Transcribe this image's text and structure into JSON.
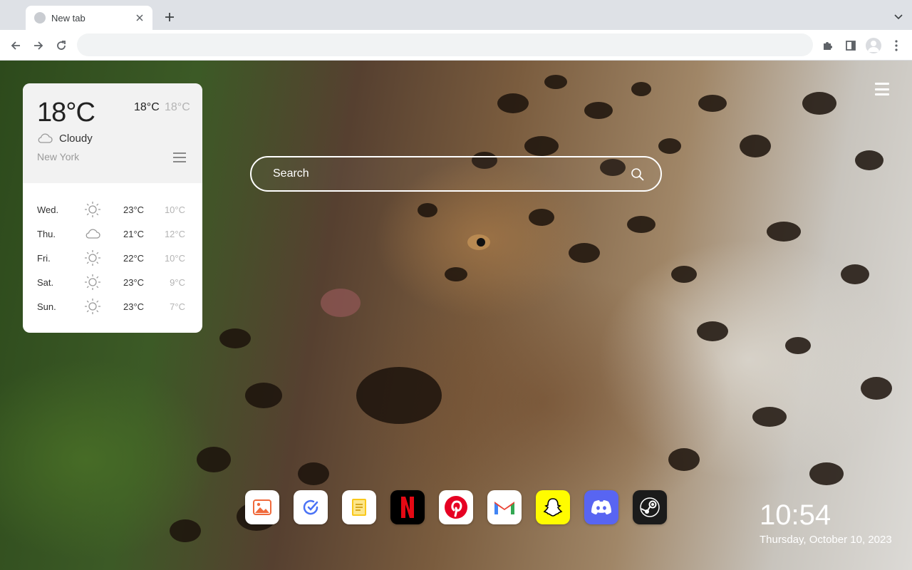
{
  "browser": {
    "tab_title": "New tab",
    "address_value": "",
    "icons": {
      "tab_close": "close-icon",
      "new_tab": "plus-icon",
      "tab_search": "chevron-down-icon",
      "back": "arrow-left-icon",
      "forward": "arrow-right-icon",
      "reload": "reload-icon",
      "extensions": "puzzle-icon",
      "side_panel": "side-panel-icon",
      "profile": "avatar-icon",
      "menu": "kebab-menu-icon"
    }
  },
  "weather": {
    "current_temp": "18°C",
    "high": "18°C",
    "low": "18°C",
    "condition": "Cloudy",
    "condition_icon": "cloud-icon",
    "city": "New York",
    "forecast": [
      {
        "day": "Wed.",
        "icon": "sun-icon",
        "high": "23°C",
        "low": "10°C"
      },
      {
        "day": "Thu.",
        "icon": "cloud-icon",
        "high": "21°C",
        "low": "12°C"
      },
      {
        "day": "Fri.",
        "icon": "sun-icon",
        "high": "22°C",
        "low": "10°C"
      },
      {
        "day": "Sat.",
        "icon": "sun-icon",
        "high": "23°C",
        "low": "9°C"
      },
      {
        "day": "Sun.",
        "icon": "sun-icon",
        "high": "23°C",
        "low": "7°C"
      }
    ]
  },
  "search": {
    "placeholder": "Search"
  },
  "apps": [
    {
      "name": "gallery-app-icon",
      "color": "#ffffff"
    },
    {
      "name": "checklist-app-icon",
      "color": "#ffffff"
    },
    {
      "name": "notes-app-icon",
      "color": "#ffffff"
    },
    {
      "name": "netflix-icon",
      "color": "#000000"
    },
    {
      "name": "pinterest-icon",
      "color": "#ffffff"
    },
    {
      "name": "gmail-icon",
      "color": "#ffffff"
    },
    {
      "name": "snapchat-icon",
      "color": "#fffc00"
    },
    {
      "name": "discord-icon",
      "color": "#5865f2"
    },
    {
      "name": "steam-icon",
      "color": "#1b1b1b"
    }
  ],
  "clock": {
    "time": "10:54",
    "date": "Thursday, October 10, 2023"
  },
  "colors": {
    "chrome_bg": "#dee1e6",
    "toolbar_bg": "#ffffff",
    "omnibox_bg": "#f1f3f4",
    "weather_header_bg": "#f2f2f2",
    "muted_text": "#b4b4b4"
  }
}
